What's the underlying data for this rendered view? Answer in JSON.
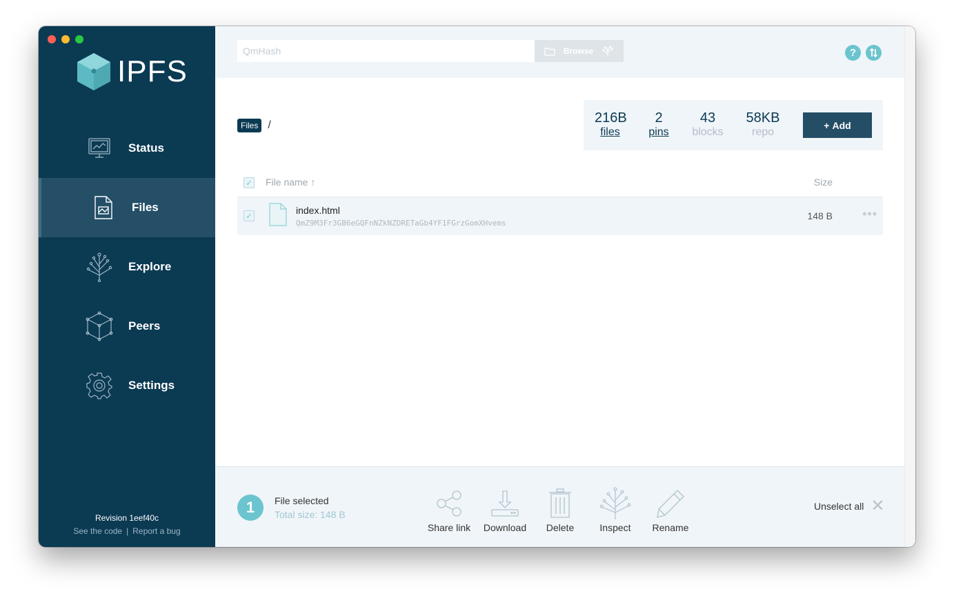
{
  "window": {
    "controls": [
      "close",
      "minimize",
      "zoom"
    ]
  },
  "sidebar": {
    "logo_text": "IPFS",
    "items": [
      {
        "label": "Status",
        "icon": "status-monitor-icon",
        "active": false
      },
      {
        "label": "Files",
        "icon": "files-document-icon",
        "active": true
      },
      {
        "label": "Explore",
        "icon": "explore-tree-icon",
        "active": false
      },
      {
        "label": "Peers",
        "icon": "peers-cube-icon",
        "active": false
      },
      {
        "label": "Settings",
        "icon": "settings-gear-icon",
        "active": false
      }
    ],
    "revision": "Revision 1eef40c",
    "see_code": "See the code",
    "separator": "|",
    "report_bug": "Report a bug"
  },
  "topbar": {
    "hash_placeholder": "QmHash",
    "browse_label": "Browse"
  },
  "breadcrumb": {
    "root": "Files",
    "separator": "/"
  },
  "stats": {
    "files": {
      "value": "216B",
      "label": "files"
    },
    "pins": {
      "value": "2",
      "label": "pins"
    },
    "blocks": {
      "value": "43",
      "label": "blocks"
    },
    "repo": {
      "value": "58KB",
      "label": "repo"
    },
    "add_label": "Add",
    "add_prefix": "+"
  },
  "table": {
    "col_name": "File name",
    "col_name_sort": "↑",
    "col_size": "Size",
    "rows": [
      {
        "name": "index.html",
        "hash": "QmZ9M3Fr3GB6eGQFnNZkNZDRETaGb4YF1FGrzGomXHvems",
        "size": "148 B",
        "selected": true
      }
    ],
    "more_dots": "•••"
  },
  "selection": {
    "count": "1",
    "title": "File selected",
    "total": "Total size: 148 B",
    "actions": {
      "share": "Share link",
      "download": "Download",
      "delete": "Delete",
      "inspect": "Inspect",
      "rename": "Rename"
    },
    "unselect_all": "Unselect all"
  },
  "colors": {
    "sidebar_bg": "#0b3a53",
    "sidebar_active": "#244f67",
    "accent_teal": "#6bc4ce",
    "navy": "#0b3a53",
    "panel_bg": "#f0f5f9"
  }
}
